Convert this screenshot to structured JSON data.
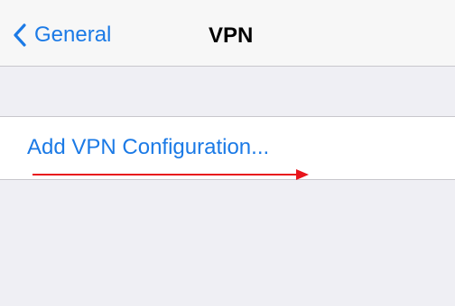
{
  "navbar": {
    "back_label": "General",
    "title": "VPN"
  },
  "vpn_list": {
    "add_label": "Add VPN Configuration..."
  },
  "colors": {
    "tint": "#1b7ae6",
    "background": "#efeff4",
    "annotation": "#e8141b"
  },
  "icons": {
    "back": "chevron-left-icon",
    "annotation": "arrow-right-icon"
  }
}
